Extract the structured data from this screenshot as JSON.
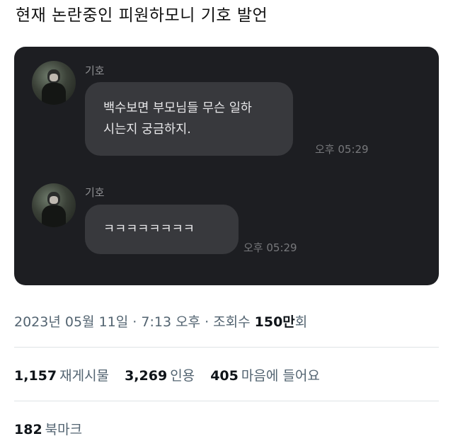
{
  "post": {
    "title": "현재 논란중인 피원하모니 기호 발언"
  },
  "chat": {
    "messages": [
      {
        "sender": "기호",
        "avatar": "profile-photo",
        "lines": [
          "백수보면 부모님들 무슨 일하",
          "시는지 궁금하지."
        ],
        "time": "오후 05:29"
      },
      {
        "sender": "기호",
        "avatar": "profile-photo",
        "lines": [
          "ㅋㅋㅋㅋㅋㅋㅋㅋ"
        ],
        "time": "오후 05:29"
      }
    ]
  },
  "meta": {
    "date": "2023년 05월 11일",
    "sep1": " · ",
    "time": "7:13 오후",
    "sep2": " · ",
    "views_label": "조회수 ",
    "views_value": "150만",
    "views_suffix": "회"
  },
  "stats": {
    "retweets": {
      "value": "1,157",
      "label": "재게시물"
    },
    "quotes": {
      "value": "3,269",
      "label": "인용"
    },
    "likes": {
      "value": "405",
      "label": "마음에 들어요"
    }
  },
  "bookmarks": {
    "value": "182",
    "label": "북마크"
  },
  "colors": {
    "chat_background": "#1d1e22",
    "bubble": "#38393d",
    "secondary_text": "#536471"
  }
}
